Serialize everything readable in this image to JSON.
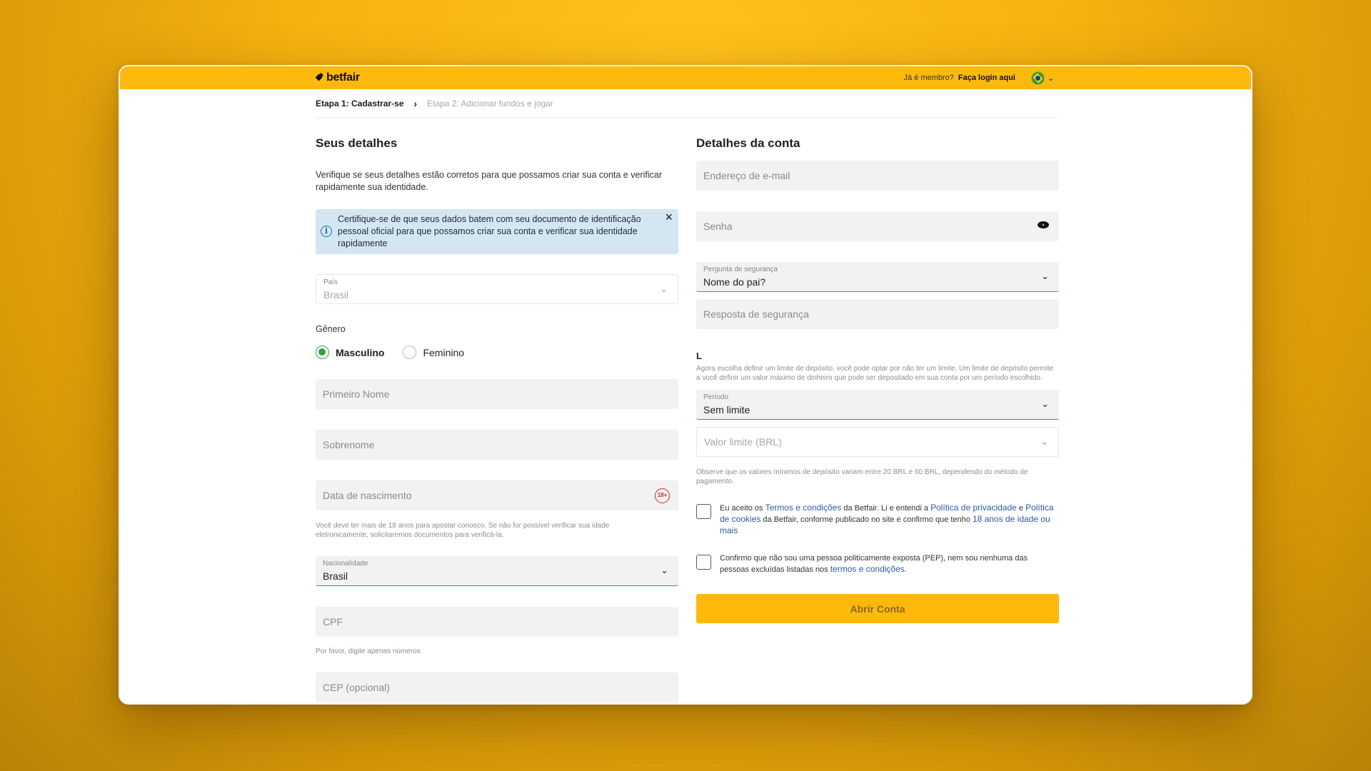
{
  "header": {
    "logo_text": "betfair",
    "member_prompt": "Já é membro?",
    "login_link": "Faça login aqui",
    "language_chevron": "⌄"
  },
  "breadcrumb": {
    "step1": "Etapa 1: Cadastrar-se",
    "separator": "›",
    "step2": "Etapa 2: Adicionar fundos e jogar"
  },
  "left": {
    "title": "Seus detalhes",
    "intro": "Verifique se seus detalhes estão corretos para que possamos criar sua conta e verificar rapidamente sua identidade.",
    "notice": "Certifique-se de que seus dados batem com seu documento de identificação pessoal oficial para que possamos criar sua conta e verificar sua identidade rapidamente",
    "country_label": "País",
    "country_value": "Brasil",
    "gender_label": "Gênero",
    "gender_male": "Masculino",
    "gender_female": "Feminino",
    "first_name_placeholder": "Primeiro Nome",
    "last_name_placeholder": "Sobrenome",
    "dob_placeholder": "Data de nascimento",
    "age_badge": "18+",
    "age_hint": "Você deve ter mais de 18 anos para apostar conosco. Se não for possível verificar sua idade eletronicamente, solicitaremos documentos para verificá-la.",
    "nationality_label": "Nacionalidade",
    "nationality_value": "Brasil",
    "cpf_placeholder": "CPF",
    "cpf_hint": "Por favor, digite apenas números",
    "cep_placeholder": "CEP (opcional)"
  },
  "right": {
    "title": "Detalhes da conta",
    "email_placeholder": "Endereço de e-mail",
    "password_placeholder": "Senha",
    "security_question_label": "Pergunta de segurança",
    "security_question_value": "Nome do pai?",
    "security_answer_placeholder": "Resposta de segurança",
    "limit_heading": "L",
    "limit_desc": "Agora escolha definir um limite de depósito, você pode optar por não ter um limite. Um limite de depósito permite a você definir um valor máximo de dinheiro que pode ser depositado em sua conta por um período escolhido.",
    "period_label": "Período",
    "period_value": "Sem limite",
    "limit_value_placeholder": "Valor limite (BRL)",
    "min_deposit_hint": "Observe que os valores mínimos de depósito variam entre 20 BRL e 60 BRL, dependendo do método de pagamento.",
    "terms": {
      "t1": "Eu aceito os ",
      "l1": "Termos e condições",
      "t2": " da Betfair. Li e entendi a ",
      "l2": "Política de privacidade",
      "t3": " e ",
      "l3": "Política de cookies",
      "t4": " da Betfair, conforme publicado no site e confirmo que tenho ",
      "l4": "18 anos de idade ou mais"
    },
    "pep": {
      "t1": "Confirmo que não sou uma pessoa politicamente exposta (PEP), nem sou nenhuma das pessoas excluídas listadas nos ",
      "l1": "termos e condições",
      "t2": "."
    },
    "submit_label": "Abrir Conta"
  }
}
